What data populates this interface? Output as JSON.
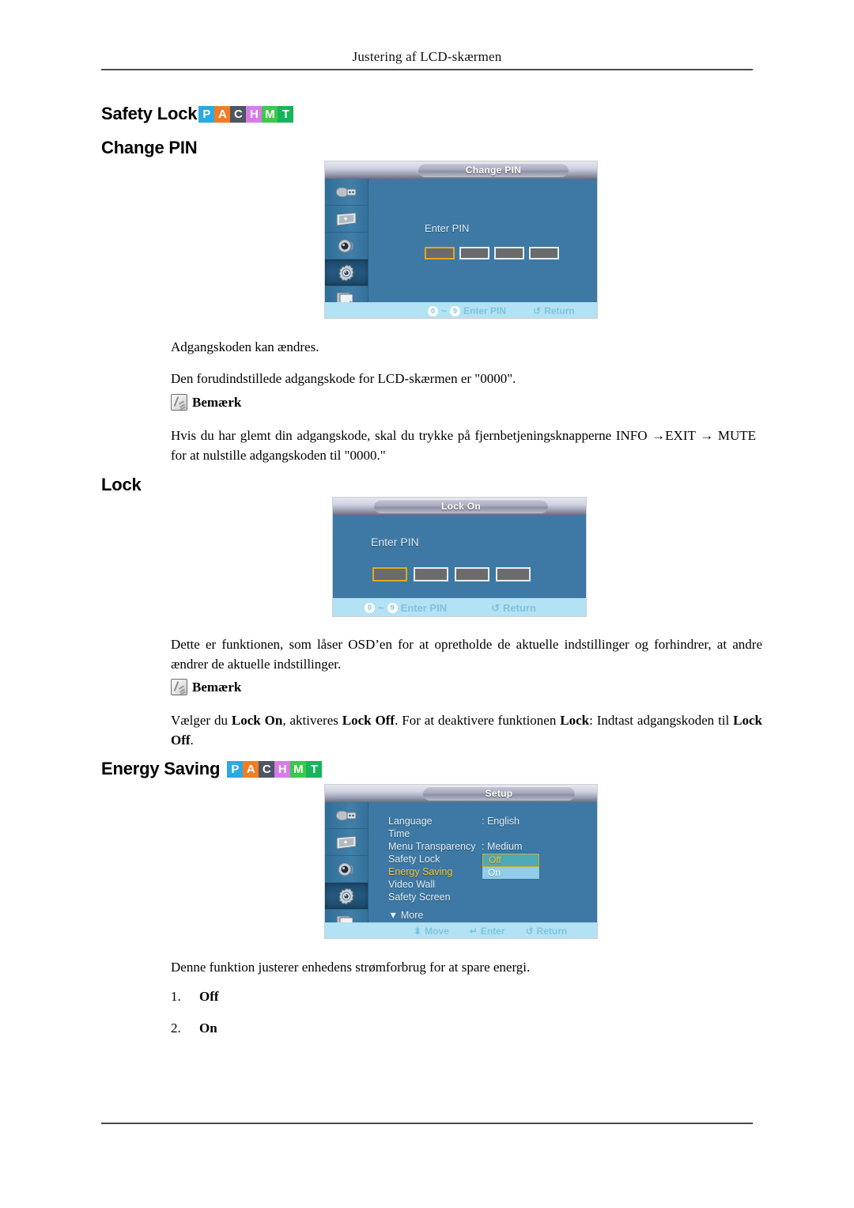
{
  "page": {
    "running_head": "Justering af LCD-skærmen"
  },
  "headings": {
    "safety_lock": "Safety Lock",
    "change_pin": "Change PIN",
    "lock": "Lock",
    "energy_saving": "Energy Saving"
  },
  "pachmt": {
    "letters": [
      "P",
      "A",
      "C",
      "H",
      "M",
      "T"
    ],
    "colors": [
      "#29abe2",
      "#f07d23",
      "#4e5563",
      "#d77bea",
      "#3cc84a",
      "#17b45e"
    ]
  },
  "change_pin_section": {
    "osd": {
      "title": "Change PIN",
      "enter_pin_label": "Enter PIN",
      "pin_boxes": 4,
      "footer": {
        "key_from": "0",
        "key_to": "9",
        "key_sep": "~",
        "action_label": "Enter PIN",
        "return_label": "Return",
        "return_icon": "↺"
      },
      "sidebar_icons": [
        "input-icon",
        "picture-icon",
        "sound-icon",
        "setup-gear-icon",
        "multi-control-icon"
      ],
      "sidebar_active_index": 3
    },
    "p1": "Adgangskoden kan ændres.",
    "p2": "Den forudindstillede adgangskode for LCD-skærmen er \"0000\".",
    "note_label": "Bemærk",
    "p3": "Hvis du har glemt din adgangskode, skal du trykke på fjernbetjeningsknapperne INFO →EXIT → MUTE for at nulstille adgangskoden til \"0000.\""
  },
  "lock_section": {
    "osd": {
      "title": "Lock On",
      "enter_pin_label": "Enter PIN",
      "pin_boxes": 4,
      "footer": {
        "key_from": "0",
        "key_to": "9",
        "key_sep": "~",
        "action_label": "Enter PIN",
        "return_label": "Return",
        "return_icon": "↺"
      }
    },
    "p1": "Dette er funktionen, som låser OSD’en for at opretholde de aktuelle indstillinger og forhindrer, at andre ændrer de aktuelle indstillinger.",
    "note_label": "Bemærk",
    "p2_pre": "Vælger du ",
    "p2_b1": "Lock On",
    "p2_mid1": ", aktiveres ",
    "p2_b2": "Lock Off",
    "p2_mid2": ". For at deaktivere funktionen ",
    "p2_b3": "Lock",
    "p2_mid3": ": Indtast adgangskoden til ",
    "p2_b4": "Lock Off",
    "p2_end": "."
  },
  "energy_saving_section": {
    "osd": {
      "title": "Setup",
      "menu": [
        {
          "name": "Language",
          "value": ": English"
        },
        {
          "name": "Time",
          "value": ""
        },
        {
          "name": "Menu Transparency",
          "value": ": Medium"
        },
        {
          "name": "Safety Lock",
          "value": ""
        },
        {
          "name": "Energy Saving",
          "value": ":",
          "highlighted": true
        },
        {
          "name": "Video Wall",
          "value": ""
        },
        {
          "name": "Safety Screen",
          "value": ""
        }
      ],
      "more_label": "More",
      "more_icon": "▼",
      "dropdown": {
        "selected": "Off",
        "options": [
          "Off",
          "On"
        ]
      },
      "footer": {
        "move_icon": "⬍",
        "move_label": "Move",
        "enter_icon": "↵",
        "enter_label": "Enter",
        "return_icon": "↺",
        "return_label": "Return"
      },
      "sidebar_icons": [
        "input-icon",
        "picture-icon",
        "sound-icon",
        "setup-gear-icon",
        "multi-control-icon"
      ],
      "sidebar_active_index": 3
    },
    "p1": "Denne funktion justerer enhedens strømforbrug for at spare energi.",
    "list": [
      {
        "num": "1.",
        "value": "Off"
      },
      {
        "num": "2.",
        "value": "On"
      }
    ]
  }
}
